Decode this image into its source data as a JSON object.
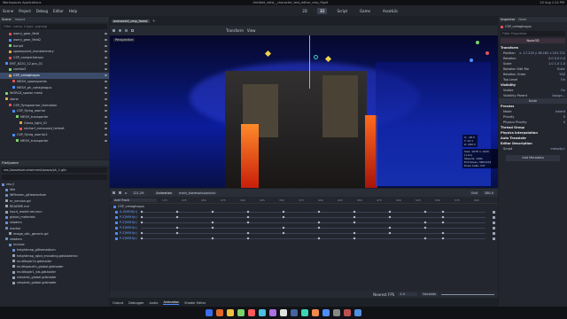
{
  "os_bar": {
    "left": "Workspaces  Applications",
    "center": "Untitled_vdist__character_test_editor_cmp_flight",
    "right": "20 Aug  1:24 PM"
  },
  "menubar": {
    "items": [
      "Scene",
      "Project",
      "Debug",
      "Editor",
      "Help"
    ],
    "modes": [
      "2D",
      "3D",
      "Script",
      "Game",
      "AssetLib"
    ],
    "active_mode": "3D"
  },
  "scene_panel": {
    "tabs": [
      "Scene",
      "Import"
    ],
    "filter_placeholder": "Filter: name, t:type, g:group",
    "nodes": [
      "worry_gear_field",
      "worry_gear_field2",
      "bonpit",
      "spawnpoint_monsterentry",
      "CSP_camperkdraon",
      "ENT_6220_12.pcs_01",
      "combo3",
      "CSP_cahaghagus",
      "MESH_spawnpoints",
      "MESH_ph_cahaghagus",
      "WORLD_spawn mesh",
      "stone",
      "CSP_flyingwarrior_formation",
      "CSP_flying_warrior",
      "MESH_transporter",
      "Gloria_light_01",
      "skcharf_armoured_helmet",
      "CSP_flying_warrior2",
      "MESH_transporter"
    ],
    "selected_index": 7
  },
  "filesystem": {
    "tab": "FileSystem",
    "path": "res://assets/environment/props/ph_1.glb",
    "items": [
      "res://",
      "idle",
      "Wiflomen_gltleanedium",
      "m_version.gd",
      "README.md",
      "input_model.res.tscn",
      "global_materials",
      "shaders",
      "marker",
      "image_atlc_generic.gd",
      "shaders",
      "include",
      "heightmap_gltleanedium",
      "heightmap_rgbd_encoding.gdshaderinc",
      "multitoptr1k.gdshader",
      "multispacefn_global.gdshader",
      "multitoptr1_bis.gdshader",
      "simplest_global.gdshader",
      "simplest_global.gdshader"
    ]
  },
  "scene_tabs": [
    "overworld_cmp_forest"
  ],
  "viewport": {
    "label": "Perspective",
    "toolbar": [
      "Transform",
      "View"
    ],
    "stats": {
      "size": "Size: 1678 × 1020 (1.0x)",
      "objects": "Objects: 1081",
      "primitives": "Primitives: 3891329",
      "draw_calls": "Draw Calls: 337"
    },
    "gizmo": {
      "x": "X: -18.3",
      "y": "Y: 23.1",
      "z": "Z: 289.3"
    }
  },
  "animation": {
    "time": "121.29",
    "tab": "Animation",
    "anim_name": "main_lowresolusionblur",
    "edit": "Edit",
    "length": "380.0",
    "add_track": "Add Track",
    "group": "CSP_cahaghagus",
    "ruler": [
      "170",
      "225",
      "250",
      "275",
      "300",
      "325",
      "350",
      "375",
      "400",
      "425",
      "450",
      "475",
      "500",
      "525",
      "550",
      "575",
      "600"
    ],
    "tracks": [
      "A-Z(MSH|n)",
      "P-Z(MSH|n)",
      "P-Z(MSH|n)",
      "P-Z(MSH|n)",
      "P-Z(MSH|n)",
      "P-Z(MSH|n)"
    ],
    "footer": {
      "fps_label": "Nearest FPS",
      "fps": "1.0",
      "snap": "Seconds"
    }
  },
  "bottom_tabs": [
    "Output",
    "Debugger",
    "Audio",
    "Animation",
    "Shader Editor"
  ],
  "inspector": {
    "tabs": [
      "Inspector",
      "Node"
    ],
    "node_name": "CSP_cahaghagus",
    "filter_placeholder": "Filter Properties",
    "section": "Node3D",
    "rows": [
      {
        "k": "Transform",
        "type": "group"
      },
      {
        "k": "Position",
        "v": "x -17.225  y 38.162  z 201.721"
      },
      {
        "k": "Rotation",
        "v": "0.0    0.0    0.0"
      },
      {
        "k": "Scale",
        "v": "1.0    1.0    1.0"
      },
      {
        "k": "Rotation Edit Mo",
        "v": "Euler"
      },
      {
        "k": "Rotation Order",
        "v": "YXZ"
      },
      {
        "k": "Top Level",
        "v": "On"
      },
      {
        "k": "Visibility",
        "type": "group"
      },
      {
        "k": "Visible",
        "v": "On"
      },
      {
        "k": "Visibility Parent",
        "v": "Assign..."
      },
      {
        "k": "Node",
        "type": "section"
      },
      {
        "k": "Process",
        "type": "group"
      },
      {
        "k": "Mode",
        "v": "Inherit"
      },
      {
        "k": "Priority",
        "v": "0"
      },
      {
        "k": "Physics Priority",
        "v": "0"
      },
      {
        "k": "Thread Group",
        "type": "group"
      },
      {
        "k": "Physics Interpolation",
        "type": "group"
      },
      {
        "k": "Auto Translate",
        "type": "group"
      },
      {
        "k": "Editor Description",
        "type": "group"
      },
      {
        "k": "Script",
        "v": "<empty>"
      }
    ],
    "add_metadata": "Add Metadata"
  },
  "colors": {
    "accent": "#4c8dff",
    "selected": "#3b4c6b",
    "lava": "#ff5a1f",
    "viewport_blue": "#0b1c9c"
  }
}
